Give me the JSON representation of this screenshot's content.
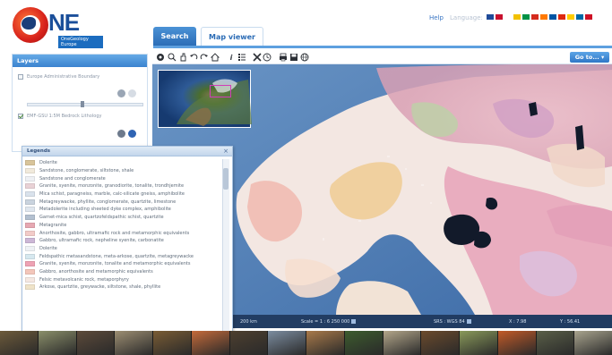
{
  "app": {
    "logo_text": "NE",
    "logo_subtitle": "OneGeology Europe"
  },
  "header": {
    "help": "Help",
    "language_label": "Language:",
    "flags": [
      "#1f4b99",
      "#c8102e",
      "#ffffff",
      "#f2c100",
      "#009246",
      "#d52b1e",
      "#ff7900",
      "#0055a4",
      "#de2910",
      "#ffcd00",
      "#006aa7",
      "#ce1126"
    ]
  },
  "tabs": [
    {
      "label": "Search"
    },
    {
      "label": "Map viewer"
    }
  ],
  "layers_panel": {
    "title": "Layers",
    "layers": [
      {
        "label": "Europe Administrative Boundary",
        "checked": false
      },
      {
        "label": "EMF-GSU 1:5M Bedrock Lithology",
        "checked": true
      }
    ]
  },
  "toolbar": {
    "icons": [
      "select-icon",
      "zoom-in-icon",
      "pan-icon",
      "undo-icon",
      "redo-icon",
      "home-icon",
      "info-icon",
      "legend-icon",
      "tools-icon",
      "clock-icon",
      "print-icon",
      "save-icon",
      "globe-icon"
    ],
    "goto_label": "Go to..."
  },
  "status": {
    "scale_bar": "200 km",
    "scale": "Scale = 1 : 6 250 000",
    "srs": "SRS : WGS 84",
    "x": "X : 7.98",
    "y": "Y : 56.41"
  },
  "legend": {
    "title": "Legends",
    "items": [
      {
        "label": "Dolerite",
        "color": "#d8c49a"
      },
      {
        "label": "Sandstone, conglomerate, siltstone, shale",
        "color": "#f1eadc"
      },
      {
        "label": "Sandstone and conglomerate",
        "color": "#eef0f4"
      },
      {
        "label": "Granite, syenite, monzonite, granodiorite, tonalite, trondhjemite",
        "color": "#e9d2d6"
      },
      {
        "label": "Mica schist, paragneiss, marble, calc-silicate gneiss, amphibolite",
        "color": "#d9e2ec"
      },
      {
        "label": "Metagreywacke, phyllite, conglomerate, quartzite, limestone",
        "color": "#c9d3de"
      },
      {
        "label": "Metadolerite including sheeted dyke complex, amphibolite",
        "color": "#dfe6ee"
      },
      {
        "label": "Garnet-mica schist, quartzofeldspathic schist, quartzite",
        "color": "#b3c0d0"
      },
      {
        "label": "Metagranite",
        "color": "#e6a8b2"
      },
      {
        "label": "Anorthosite, gabbro, ultramafic rock and metamorphic equivalents",
        "color": "#f2cbc8"
      },
      {
        "label": "Gabbro, ultramafic rock, nepheline syenite, carbonatite",
        "color": "#ccb7d6"
      },
      {
        "label": "Dolerite",
        "color": "#eef1f5"
      },
      {
        "label": "Feldspathic metasandstone, meta-arkose, quartzite, metagreywacke",
        "color": "#d6e8ef"
      },
      {
        "label": "Granite, syenite, monzonite, tonalite and metamorphic equivalents",
        "color": "#eea2b4"
      },
      {
        "label": "Gabbro, anorthosite and metamorphic equivalents",
        "color": "#f3c6ba"
      },
      {
        "label": "Felsic metavolcanic rock, metaporphyry",
        "color": "#f5e8e2"
      },
      {
        "label": "Arkose, quartzite, greywacke, siltstone, shale, phyllite",
        "color": "#efe3c9"
      }
    ]
  },
  "photo_strip": [
    "#6d5a3a",
    "#8b8f6a",
    "#5c4a3a",
    "#9d8e72",
    "#7a5c34",
    "#c46a3a",
    "#4d3f2f",
    "#7c8da0",
    "#a97a4a",
    "#3d5c2e",
    "#b3a68a",
    "#6b4a2c",
    "#8a9a5a",
    "#c25a28",
    "#5a5f48",
    "#a9a48e"
  ]
}
